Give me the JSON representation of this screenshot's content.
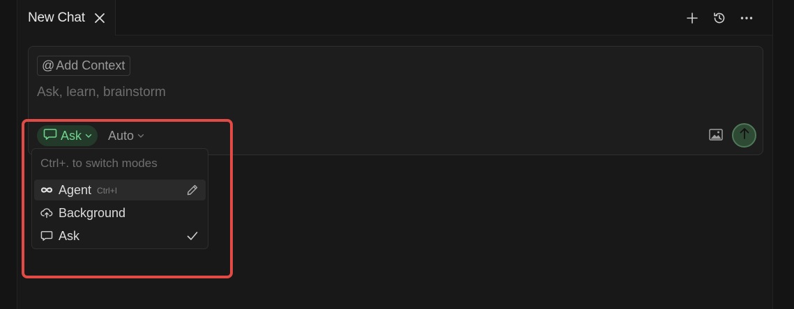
{
  "tab": {
    "title": "New Chat"
  },
  "header_actions": [
    {
      "icon": "plus-icon"
    },
    {
      "icon": "history-icon"
    },
    {
      "icon": "more-icon"
    }
  ],
  "composer": {
    "add_context_at": "@",
    "add_context_label": "Add Context",
    "placeholder": "Ask, learn, brainstorm",
    "mode_label": "Ask",
    "model_label": "Auto"
  },
  "mode_menu": {
    "hint": "Ctrl+. to switch modes",
    "items": [
      {
        "label": "Agent",
        "shortcut": "Ctrl+I",
        "icon": "infinity-icon",
        "right_icon": "pencil-icon",
        "highlighted": true
      },
      {
        "label": "Background",
        "icon": "cloud-upload-icon"
      },
      {
        "label": "Ask",
        "icon": "chat-bubble-icon",
        "selected": true,
        "right_icon": "check-icon"
      }
    ]
  },
  "colors": {
    "accent_green": "#6fd48d",
    "highlight_red": "#e24a46"
  }
}
